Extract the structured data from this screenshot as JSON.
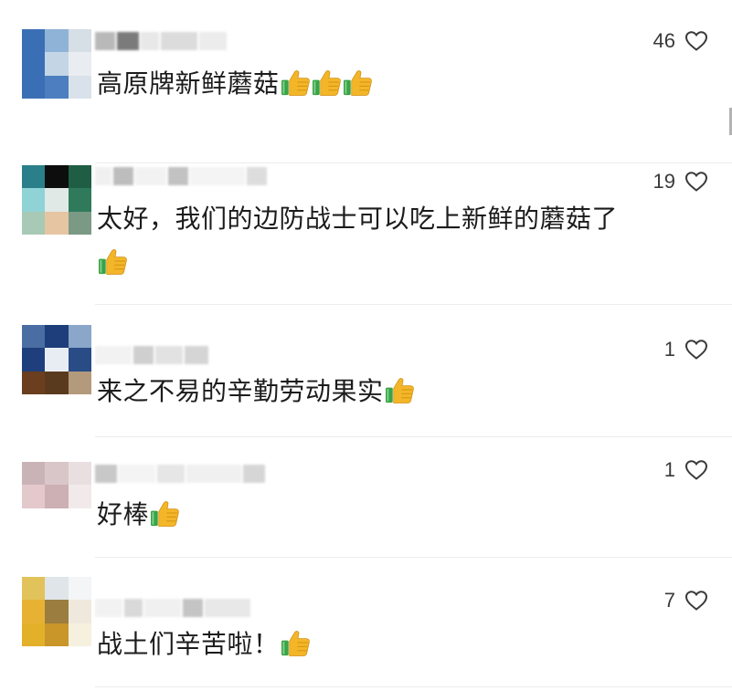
{
  "comments": [
    {
      "text": "高原牌新鲜蘑菇",
      "likes": "46",
      "thumbs": 3,
      "avatar_colors": [
        "#3a6fb5",
        "#8fb3d6",
        "#d6dee6",
        "#3a6fb5",
        "#c4d5e6",
        "#e9edf1",
        "#3a6fb5",
        "#4d7fc0",
        "#d9e2ea"
      ],
      "name_colors": [
        "#b9b9b9",
        "#7b7b7b",
        "#e8e8e8",
        "#dcdcdc",
        "#ececec"
      ]
    },
    {
      "text": "太好，我们的边防战士可以吃上新鲜的蘑菇了",
      "likes": "19",
      "thumbs": 1,
      "avatar_colors": [
        "#2a7f8a",
        "#0d0d0d",
        "#1f5e44",
        "#8fd3d6",
        "#e1e9e6",
        "#2f7a5b",
        "#a8c9b5",
        "#e6c5a3",
        "#7a9a85"
      ],
      "name_colors": [
        "#f0f0f0",
        "#bdbdbd",
        "#f2f2f2",
        "#c2c2c2",
        "#f4f4f4",
        "#dddddd"
      ]
    },
    {
      "text": "来之不易的辛勤劳动果实",
      "likes": "1",
      "thumbs": 1,
      "avatar_colors": [
        "#4a6da3",
        "#1d3e7a",
        "#8aa6c9",
        "#1e3f7c",
        "#e8edf4",
        "#2a4c86",
        "#6a3e1e",
        "#5a3a1e",
        "#b49a7c"
      ],
      "name_colors": [
        "#f2f2f2",
        "#cfcfcf",
        "#e2e2e2",
        "#d5d5d5"
      ]
    },
    {
      "text": "好棒",
      "likes": "1",
      "thumbs": 1,
      "avatar_colors": [
        "#c9b3b6",
        "#d9c6c8",
        "#e9dfe0",
        "#e4c9cc",
        "#cdb0b3",
        "#f1e9ea",
        "#ffffff",
        "#ffffff",
        "#ffffff"
      ],
      "name_colors": [
        "#c8c8c8",
        "#f4f4f4",
        "#e6e6e6",
        "#f0f0f0",
        "#d6d6d6"
      ]
    },
    {
      "text": "战土们辛苦啦！",
      "likes": "7",
      "thumbs": 1,
      "avatar_colors": [
        "#e2c25a",
        "#dfe5e8",
        "#f3f5f6",
        "#e7b233",
        "#9a7d3f",
        "#efe9dd",
        "#e3b02a",
        "#c9962a",
        "#f6f0de"
      ],
      "name_colors": [
        "#f2f2f2",
        "#d9d9d9",
        "#f0f0f0",
        "#c4c4c4",
        "#e8e8e8"
      ]
    }
  ],
  "icons": {
    "heart": "heart-icon",
    "thumbs_up": "thumbs-up-icon"
  },
  "colors": {
    "thumb_yellow": "#f4b629",
    "thumb_cuff": "#3aa346",
    "heart_stroke": "#3a3a3a",
    "divider": "#ececec"
  }
}
